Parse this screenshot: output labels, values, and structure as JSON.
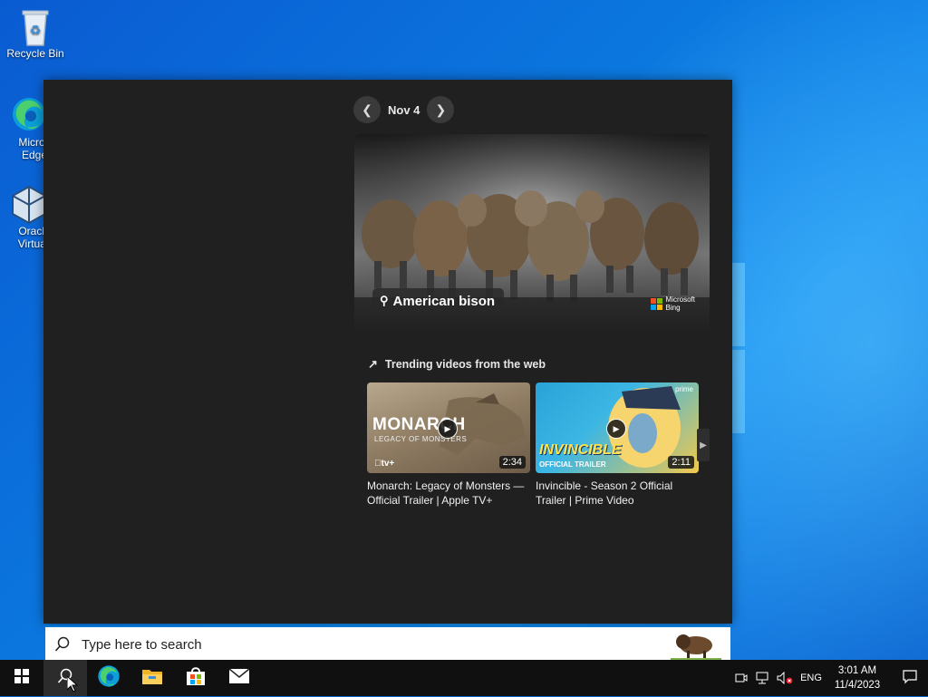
{
  "desktop": {
    "icons": [
      {
        "label": "Recycle Bin",
        "icon": "recycle-bin-icon"
      },
      {
        "label": "Microsoft Edge",
        "line1": "Micros",
        "line2": "Edge",
        "icon": "edge-icon"
      },
      {
        "label": "Oracle VirtualBox",
        "line1": "Oracle",
        "line2": "Virtuall",
        "icon": "virtualbox-icon"
      }
    ]
  },
  "panel": {
    "date_nav": {
      "prev_icon": "chevron-left-icon",
      "date": "Nov 4",
      "next_icon": "chevron-right-icon"
    },
    "hero": {
      "caption": "American bison",
      "caption_icon": "location-pin-icon",
      "brand_line1": "Microsoft",
      "brand_line2": "Bing"
    },
    "trending": {
      "title": "Trending videos from the web",
      "icon": "trending-icon",
      "videos": [
        {
          "thumb_title": "MONARCH",
          "thumb_subtitle": "LEGACY OF MONSTERS",
          "thumb_badge": "tv+",
          "duration": "2:34",
          "title": "Monarch: Legacy of Monsters — Official Trailer | Apple TV+"
        },
        {
          "thumb_title": "INVINCIBLE",
          "thumb_subtitle": "OFFICIAL TRAILER",
          "thumb_badge": "prime",
          "duration": "2:11",
          "title": "Invincible - Season 2 Official Trailer | Prime Video"
        }
      ]
    }
  },
  "search": {
    "placeholder": "Type here to search",
    "icon": "search-icon"
  },
  "taskbar": {
    "apps": [
      {
        "name": "start",
        "icon": "windows-logo-icon"
      },
      {
        "name": "search",
        "icon": "search-icon"
      },
      {
        "name": "edge",
        "icon": "edge-icon"
      },
      {
        "name": "file-explorer",
        "icon": "folder-icon"
      },
      {
        "name": "store",
        "icon": "store-icon"
      },
      {
        "name": "mail",
        "icon": "mail-icon"
      }
    ],
    "tray": {
      "language": "ENG",
      "time": "3:01 AM",
      "date": "11/4/2023"
    }
  },
  "colors": {
    "panel_bg": "#202020",
    "accent": "#0078d4",
    "taskbar_bg": "#101010"
  }
}
